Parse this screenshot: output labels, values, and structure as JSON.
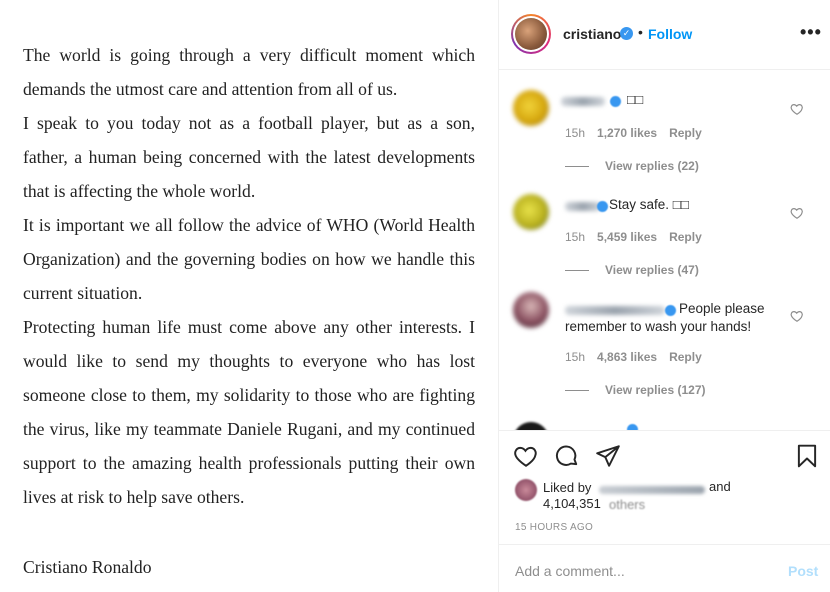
{
  "post": {
    "paragraphs": [
      "The world is going through a very difficult moment which demands the utmost care and attention from all of us.",
      "I speak to you today not as a football player, but as a son, father, a human being concerned with the latest developments that is affecting the whole world.",
      "It is important we all follow the advice of WHO (World Health Organization) and the governing bodies on how we handle this current situation.",
      "Protecting human life must come above any other interests. I would like to send my thoughts to everyone who has lost someone close to them, my solidarity to those who are fighting the virus, like my teammate Daniele Rugani, and my continued support to the amazing health professionals putting their own lives at risk to help save others."
    ],
    "signature": "Cristiano Ronaldo"
  },
  "header": {
    "username": "cristiano",
    "verified_icon": "✓",
    "dot": "•",
    "follow_label": "Follow",
    "more_label": "•••"
  },
  "comments": [
    {
      "text": "□□",
      "time": "15h",
      "likes": "1,270 likes",
      "reply": "Reply",
      "view_replies": "View replies (22)"
    },
    {
      "text": "Stay safe. □□",
      "time": "15h",
      "likes": "5,459 likes",
      "reply": "Reply",
      "view_replies": "View replies (47)"
    },
    {
      "text_line1": "People please",
      "text_line2": "remember to wash your hands!",
      "time": "15h",
      "likes": "4,863 likes",
      "reply": "Reply",
      "view_replies": "View replies (127)"
    }
  ],
  "likes": {
    "liked_by": "Liked by",
    "and": "and",
    "count": "4,104,351",
    "others": "others"
  },
  "time_ago": "15 HOURS AGO",
  "add_comment": {
    "placeholder": "Add a comment...",
    "post_label": "Post"
  },
  "icons": [
    "heart-icon",
    "comment-icon",
    "share-icon",
    "bookmark-icon",
    "more-icon",
    "verified-icon"
  ]
}
